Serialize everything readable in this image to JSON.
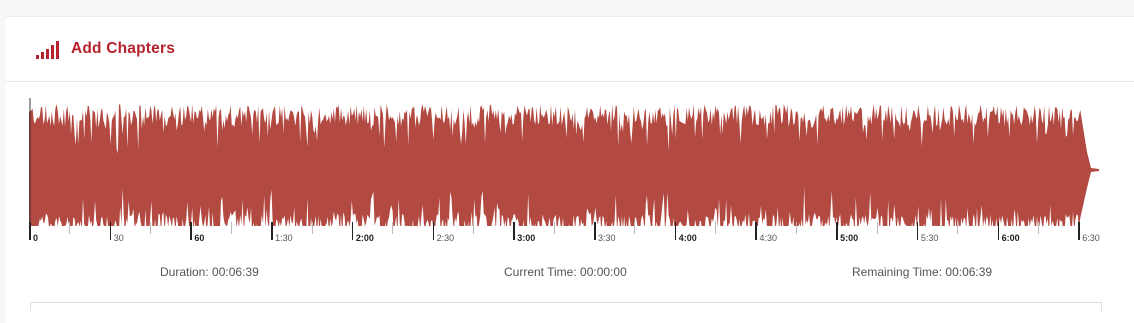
{
  "header": {
    "title": "Add Chapters",
    "icon": "signal-bars-icon",
    "accent_color": "#b5222b"
  },
  "waveform": {
    "color": "#b34a42",
    "timeline_labels": [
      {
        "label": "0",
        "seconds": 0,
        "major": true
      },
      {
        "label": "30",
        "seconds": 30,
        "major": false
      },
      {
        "label": "60",
        "seconds": 60,
        "major": true
      },
      {
        "label": "1:30",
        "seconds": 90,
        "major": false
      },
      {
        "label": "2:00",
        "seconds": 120,
        "major": true
      },
      {
        "label": "2:30",
        "seconds": 150,
        "major": false
      },
      {
        "label": "3:00",
        "seconds": 180,
        "major": true
      },
      {
        "label": "3:30",
        "seconds": 210,
        "major": false
      },
      {
        "label": "4:00",
        "seconds": 240,
        "major": true
      },
      {
        "label": "4:30",
        "seconds": 270,
        "major": false
      },
      {
        "label": "5:00",
        "seconds": 300,
        "major": true
      },
      {
        "label": "5:30",
        "seconds": 330,
        "major": false
      },
      {
        "label": "6:00",
        "seconds": 360,
        "major": true
      },
      {
        "label": "6:30",
        "seconds": 390,
        "major": false
      }
    ],
    "total_seconds": 399
  },
  "info": {
    "duration_label": "Duration:",
    "duration_value": "00:06:39",
    "current_label": "Current Time:",
    "current_value": "00:00:00",
    "remaining_label": "Remaining Time:",
    "remaining_value": "00:06:39"
  }
}
